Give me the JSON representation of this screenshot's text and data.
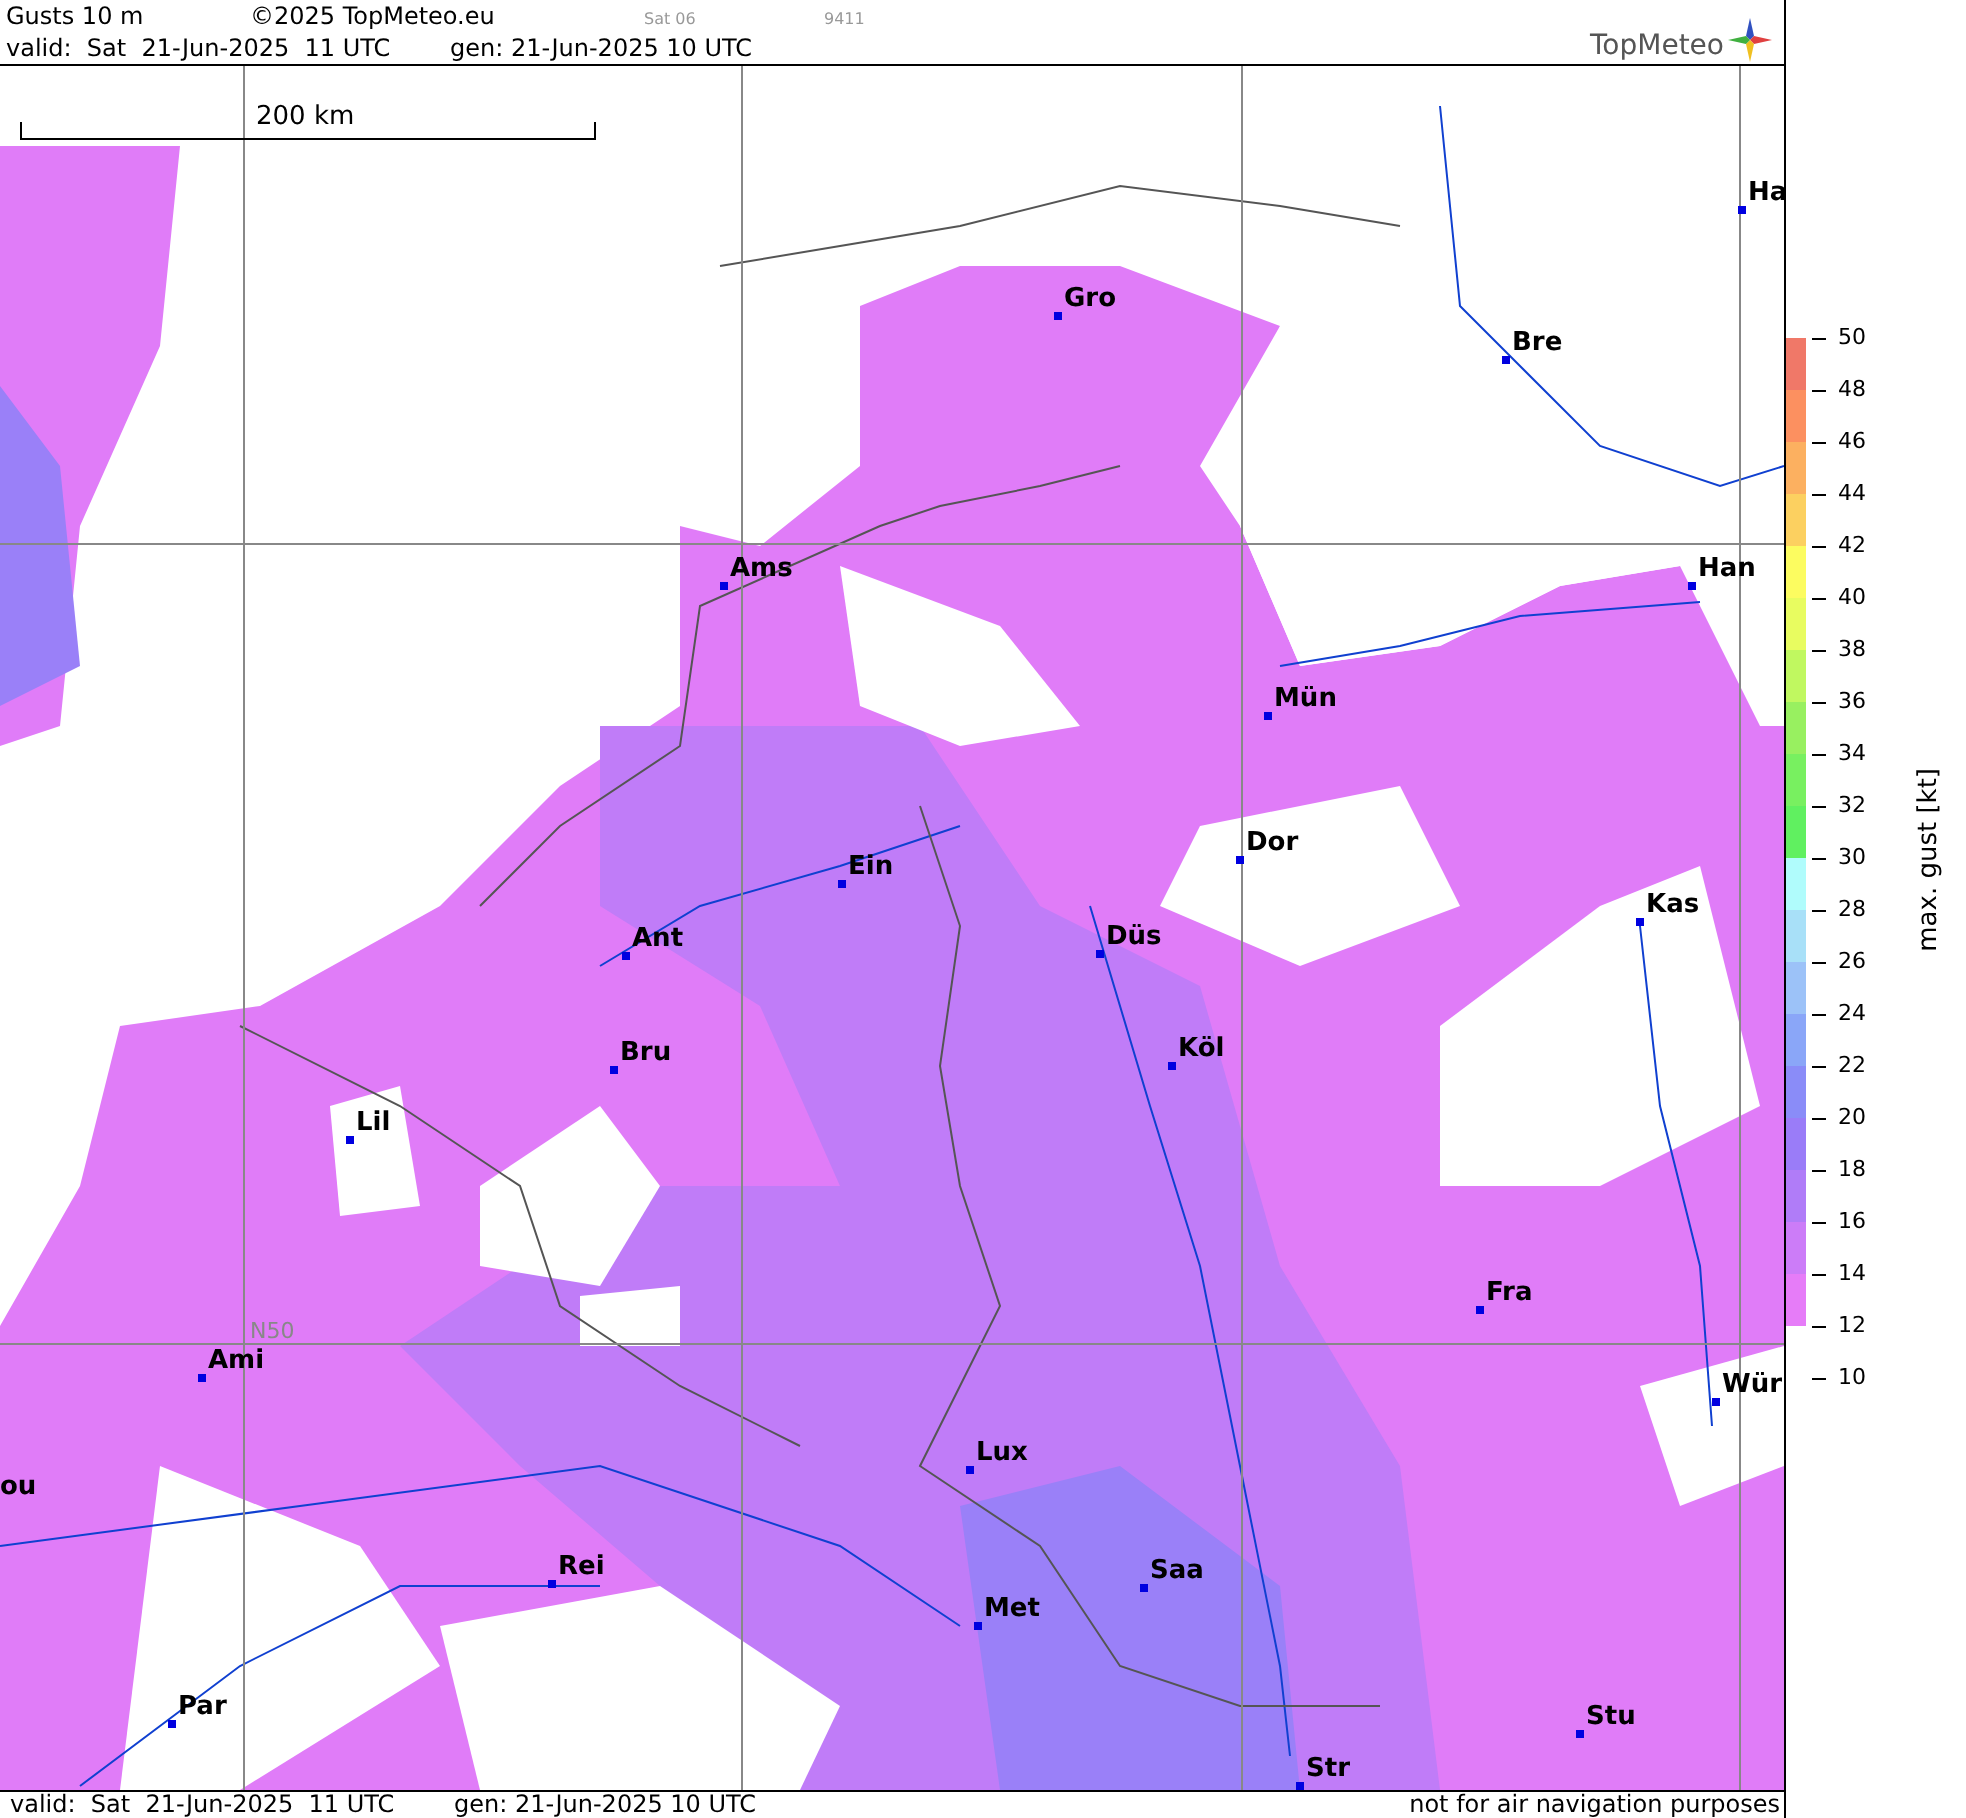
{
  "header": {
    "title": "Gusts 10 m",
    "copyright": "©2025 TopMeteo.eu",
    "run": "Sat 06",
    "code": "9411",
    "valid": "valid:  Sat  21-Jun-2025  11 UTC",
    "generated": "gen: 21-Jun-2025 10 UTC",
    "logo": "TopMeteo"
  },
  "map": {
    "scale": "200 km",
    "latitude_label": "N50",
    "cities": [
      {
        "name": "Ha",
        "kind": "city"
      },
      {
        "name": "Bre",
        "kind": "city"
      },
      {
        "name": "Gro",
        "kind": "city"
      },
      {
        "name": "Ams",
        "kind": "city"
      },
      {
        "name": "Han",
        "kind": "city"
      },
      {
        "name": "Mün",
        "kind": "city"
      },
      {
        "name": "Dor",
        "kind": "city"
      },
      {
        "name": "Ein",
        "kind": "city"
      },
      {
        "name": "Kas",
        "kind": "city"
      },
      {
        "name": "Düs",
        "kind": "city"
      },
      {
        "name": "Ant",
        "kind": "city"
      },
      {
        "name": "Bru",
        "kind": "city"
      },
      {
        "name": "Köl",
        "kind": "city"
      },
      {
        "name": "Lil",
        "kind": "city"
      },
      {
        "name": "Fra",
        "kind": "city"
      },
      {
        "name": "Ami",
        "kind": "city"
      },
      {
        "name": "Wür",
        "kind": "city"
      },
      {
        "name": "ou",
        "kind": "clipped"
      },
      {
        "name": "Lux",
        "kind": "city"
      },
      {
        "name": "Rei",
        "kind": "city"
      },
      {
        "name": "Saa",
        "kind": "city"
      },
      {
        "name": "Met",
        "kind": "city"
      },
      {
        "name": "Par",
        "kind": "city"
      },
      {
        "name": "Stu",
        "kind": "city"
      },
      {
        "name": "Str",
        "kind": "city"
      }
    ]
  },
  "legend": {
    "title": "max. gust [kt]",
    "ticks": [
      "50",
      "48",
      "46",
      "44",
      "42",
      "40",
      "38",
      "36",
      "34",
      "32",
      "30",
      "28",
      "26",
      "24",
      "22",
      "20",
      "18",
      "16",
      "14",
      "12",
      "10"
    ],
    "bands": [
      {
        "color": "#f07868"
      },
      {
        "color": "#fc9060"
      },
      {
        "color": "#fcb060"
      },
      {
        "color": "#fcd060"
      },
      {
        "color": "#fcfc60"
      },
      {
        "color": "#e8fc60"
      },
      {
        "color": "#c0f860"
      },
      {
        "color": "#98f060"
      },
      {
        "color": "#78f060"
      },
      {
        "color": "#60f060"
      },
      {
        "color": "#b0fcfc"
      },
      {
        "color": "#a8e0f8"
      },
      {
        "color": "#9cc2f8"
      },
      {
        "color": "#8aa6f8"
      },
      {
        "color": "#8a8cf8"
      },
      {
        "color": "#9a7cf8"
      },
      {
        "color": "#b07cf8"
      },
      {
        "color": "#cc7cf8"
      },
      {
        "color": "#e67cf8"
      }
    ]
  },
  "footer": {
    "valid": "valid:  Sat  21-Jun-2025  11 UTC",
    "generated": "gen: 21-Jun-2025 10 UTC",
    "notice": "not for air navigation purposes"
  }
}
